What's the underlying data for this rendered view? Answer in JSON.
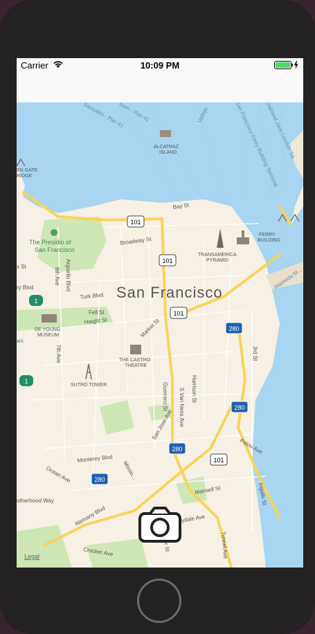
{
  "status_bar": {
    "carrier": "Carrier",
    "time": "10:09 PM",
    "icons": [
      "wifi-icon",
      "battery-icon",
      "charging-bolt-icon"
    ],
    "battery_color": "#4cd964"
  },
  "map": {
    "city_label": "San Francisco",
    "legal_label": "Legal",
    "water_color": "#a7d5f2",
    "land_color": "#f6f1e4",
    "park_color": "#cfe6b5",
    "highway_color": "#f9d35a",
    "labels": {
      "alcatraz": "ALCATRAZ\nISLAND",
      "presidio": "The Presidio of\nSan Francisco",
      "transamerica": "TRANSAMERICA\nPYRAMID",
      "ferry": "FERRY\nBUILDING",
      "deyoung": "DE YOUNG\nMUSEUM",
      "castro": "THE CASTRO\nTHEATRE",
      "sutro": "SUTRO TOWER",
      "bay_st": "Bay St",
      "broadway": "Broadway St",
      "turk": "Turk Blvd",
      "fell": "Fell St",
      "haight": "Haight St",
      "market": "Market St",
      "guerrero": "Guerrero St",
      "van_ness": "S Van Ness Ave",
      "harrison": "Harrison St",
      "third": "3rd St",
      "san_jose": "San Jose Ave",
      "monterey": "Monterey Blvd",
      "ocean": "Ocean Ave",
      "mansell": "Mansell St",
      "sunnydale": "Sunnydale Ave",
      "palou": "Palou Ave",
      "ingalls": "Ingalls St",
      "alemany": "Alemany Blvd",
      "crocker": "Crocker Ave",
      "tunnel": "Tunnel Ave",
      "carter": "Carter St",
      "sausalito": "Sausalito - Pier 41",
      "alameda": "Alameda M...",
      "oakland": "Oakland Jack London Sq",
      "ferry_terminal": "San Francisco Ferry Building Terminal",
      "arguello": "Arguello Blvd",
      "sixth": "6th Ave",
      "seventh": "7th Ave",
      "gate_bridge": "EN GATE\nRIDGE",
      "park": "ark",
      "x_st": "x St",
      "ry_blvd": "ry Blvd",
      "mission": "Missio...",
      "otherhood": "otherhood Way",
      "burn": "burn - Pier 41",
      "vallejo": "Vallejo"
    },
    "shields": [
      "101",
      "101",
      "101",
      "280",
      "280",
      "280",
      "280",
      "101",
      "1",
      "1"
    ]
  },
  "camera_button": {
    "icon": "camera-icon"
  }
}
